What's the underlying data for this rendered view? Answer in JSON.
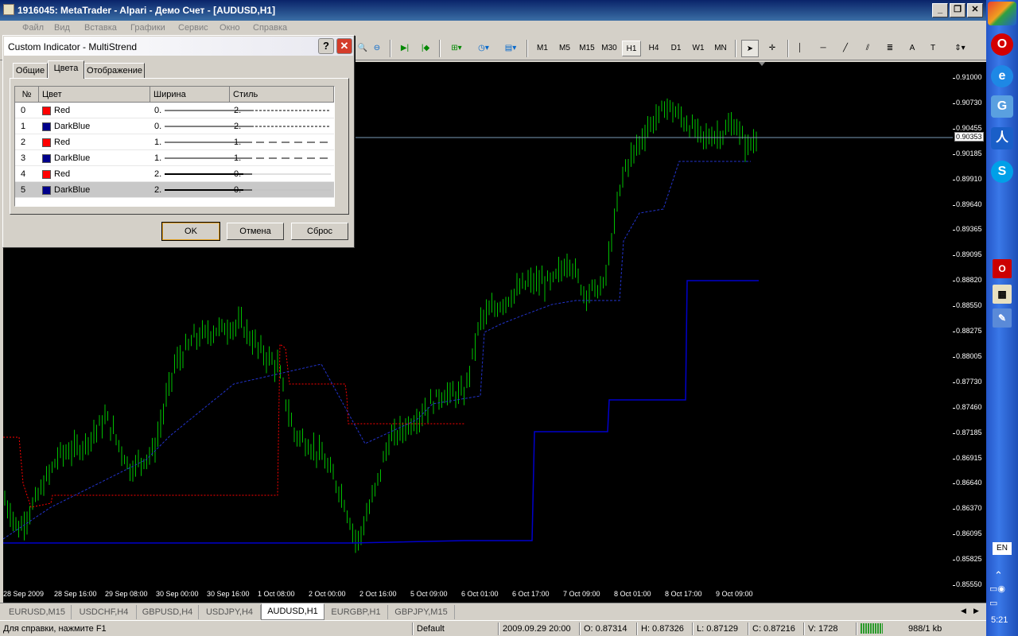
{
  "window": {
    "title": "1916045: MetaTrader - Alpari - Демо Счет - [AUDUSD,H1]"
  },
  "menu": [
    "Файл",
    "Вид",
    "Вставка",
    "Графики",
    "Сервис",
    "Окно",
    "Справка"
  ],
  "timeframes": [
    "M1",
    "M5",
    "M15",
    "M30",
    "H1",
    "H4",
    "D1",
    "W1",
    "MN"
  ],
  "active_timeframe": "H1",
  "dialog": {
    "title": "Custom Indicator - MultiStrend",
    "help": "?",
    "close": "✕",
    "tabs": [
      "Общие",
      "Цвета",
      "Отображение"
    ],
    "active_tab": "Цвета",
    "columns": [
      "№",
      "Цвет",
      "Ширина",
      "Стиль"
    ],
    "rows": [
      {
        "n": "0",
        "color": "Red",
        "hex": "#ff0000",
        "width": "0.",
        "style": "2.",
        "lw": 1,
        "dash": "3,2"
      },
      {
        "n": "1",
        "color": "DarkBlue",
        "hex": "#00008b",
        "width": "0.",
        "style": "2.",
        "lw": 1,
        "dash": "3,2"
      },
      {
        "n": "2",
        "color": "Red",
        "hex": "#ff0000",
        "width": "1.",
        "style": "1.",
        "lw": 1,
        "dash": "10,6"
      },
      {
        "n": "3",
        "color": "DarkBlue",
        "hex": "#00008b",
        "width": "1.",
        "style": "1.",
        "lw": 1,
        "dash": "10,6"
      },
      {
        "n": "4",
        "color": "Red",
        "hex": "#ff0000",
        "width": "2.",
        "style": "0.",
        "lw": 2,
        "dash": ""
      },
      {
        "n": "5",
        "color": "DarkBlue",
        "hex": "#00008b",
        "width": "2.",
        "style": "0.",
        "lw": 2,
        "dash": ""
      }
    ],
    "selected_row": "5",
    "buttons": {
      "ok": "OK",
      "cancel": "Отмена",
      "reset": "Сброс"
    }
  },
  "price_axis": [
    "0.91000",
    "0.90730",
    "0.90455",
    "0.90185",
    "0.89910",
    "0.89640",
    "0.89365",
    "0.89095",
    "0.88820",
    "0.88550",
    "0.88275",
    "0.88005",
    "0.87730",
    "0.87460",
    "0.87185",
    "0.86915",
    "0.86640",
    "0.86370",
    "0.86095",
    "0.85825",
    "0.85550"
  ],
  "current_price": "0.90353",
  "time_axis": [
    "28 Sep 2009",
    "28 Sep 16:00",
    "29 Sep 08:00",
    "30 Sep 00:00",
    "30 Sep 16:00",
    "1 Oct 08:00",
    "2 Oct 00:00",
    "2 Oct 16:00",
    "5 Oct 09:00",
    "6 Oct 01:00",
    "6 Oct 17:00",
    "7 Oct 09:00",
    "8 Oct 01:00",
    "8 Oct 17:00",
    "9 Oct 09:00"
  ],
  "symbol_tabs": [
    "EURUSD,M15",
    "USDCHF,H4",
    "GBPUSD,H4",
    "USDJPY,H4",
    "AUDUSD,H1",
    "EURGBP,H1",
    "GBPJPY,M15"
  ],
  "active_symbol_tab": "AUDUSD,H1",
  "status": {
    "help": "Для справки, нажмите F1",
    "profile": "Default",
    "datetime": "2009.09.29 20:00",
    "open": "O: 0.87314",
    "high": "H: 0.87326",
    "low": "L: 0.87129",
    "close": "C: 0.87216",
    "volume": "V: 1728",
    "traffic": "988/1 kb"
  },
  "taskbar": {
    "clock": "5:21",
    "lang": "EN"
  },
  "colors": {
    "bars": "#00c000",
    "red_line": "#ff0000",
    "blue_line": "#0000cc",
    "bg": "#000000"
  }
}
